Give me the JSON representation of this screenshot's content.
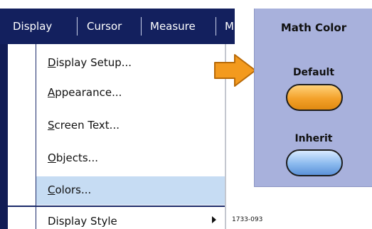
{
  "menubar": {
    "tabs": [
      {
        "label": "Display"
      },
      {
        "label": "Cursor"
      },
      {
        "label": "Measure"
      },
      {
        "label": "M"
      }
    ]
  },
  "dropdown": {
    "items": [
      {
        "label": "Display Setup...",
        "mnemonic": "D"
      },
      {
        "label": "Appearance...",
        "mnemonic": "A"
      },
      {
        "label": "Screen Text...",
        "mnemonic": "S"
      },
      {
        "label": "Objects...",
        "mnemonic": "O"
      },
      {
        "label": "Colors...",
        "mnemonic": "C",
        "selected": true
      },
      {
        "label": "Display Style",
        "mnemonic": "",
        "submenu": true
      }
    ]
  },
  "panel": {
    "title": "Math Color",
    "buttons": [
      {
        "label": "Default",
        "color": "#f3a12a"
      },
      {
        "label": "Inherit",
        "color": "#8ab9ee"
      }
    ]
  },
  "arrow_color": "#f39a1e",
  "figure_code": "1733-093"
}
